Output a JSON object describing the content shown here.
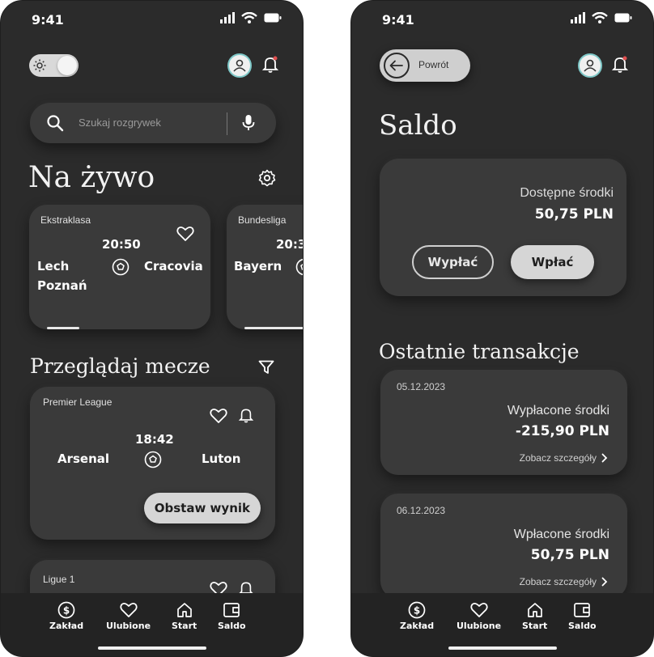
{
  "left": {
    "status_time": "9:41",
    "search_placeholder": "Szukaj rozgrywek",
    "live_title": "Na żywo",
    "live_matches": [
      {
        "league": "Ekstraklasa",
        "time": "20:50",
        "home": "Lech\nPoznań",
        "away": "Cracovia"
      },
      {
        "league": "Bundesliga",
        "time": "20:3",
        "home": "Bayern",
        "away": ""
      }
    ],
    "browse_title": "Przeglądaj mecze",
    "matches": [
      {
        "league": "Premier League",
        "time": "18:42",
        "home": "Arsenal",
        "away": "Luton",
        "bet_label": "Obstaw wynik"
      },
      {
        "league": "Ligue 1"
      }
    ]
  },
  "right": {
    "status_time": "9:41",
    "back_label": "Powrót",
    "title": "Saldo",
    "available_label": "Dostępne środki",
    "available_amount": "50,75 PLN",
    "withdraw_label": "Wypłać",
    "deposit_label": "Wpłać",
    "transactions_title": "Ostatnie transakcje",
    "transactions": [
      {
        "date": "05.12.2023",
        "label": "Wypłacone środki",
        "amount": "-215,90 PLN",
        "link": "Zobacz szczegóły"
      },
      {
        "date": "06.12.2023",
        "label": "Wpłacone środki",
        "amount": "50,75 PLN",
        "link": "Zobacz szczegóły"
      }
    ]
  },
  "tabbar": {
    "items": [
      {
        "label": "Zakład",
        "icon": "dollar-icon"
      },
      {
        "label": "Ulubione",
        "icon": "heart-icon"
      },
      {
        "label": "Start",
        "icon": "home-icon"
      },
      {
        "label": "Saldo",
        "icon": "wallet-icon"
      }
    ]
  },
  "colors": {
    "background": "#2b2b2b",
    "card": "#3a3a3a",
    "accent_button": "#d6d6d6",
    "avatar_ring": "#7ec8c8",
    "notification_dot": "#e05050"
  }
}
